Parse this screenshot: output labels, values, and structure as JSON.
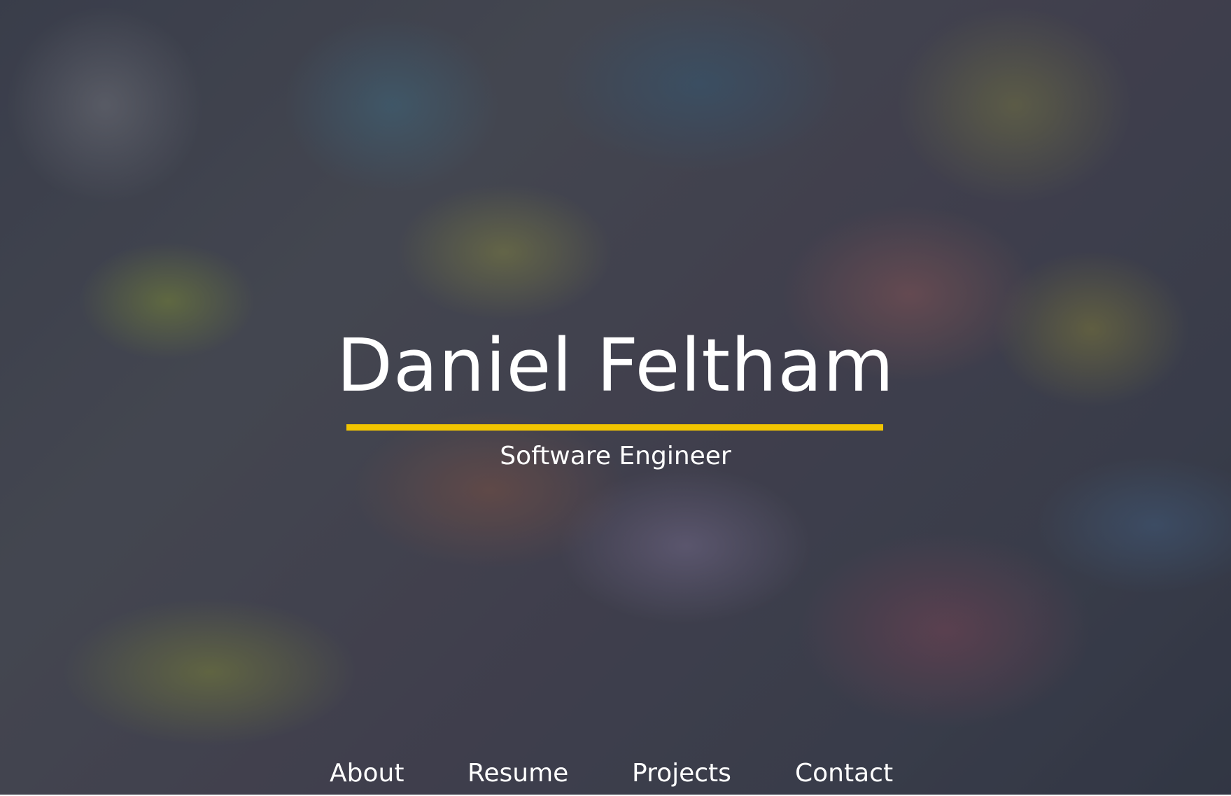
{
  "hero": {
    "name": "Daniel Feltham",
    "subtitle": "Software Engineer",
    "accent_color": "#f2c500",
    "background": "graffiti wall photo with dark overlay"
  },
  "nav": {
    "items": [
      {
        "label": "About"
      },
      {
        "label": "Resume"
      },
      {
        "label": "Projects"
      },
      {
        "label": "Contact"
      }
    ]
  }
}
